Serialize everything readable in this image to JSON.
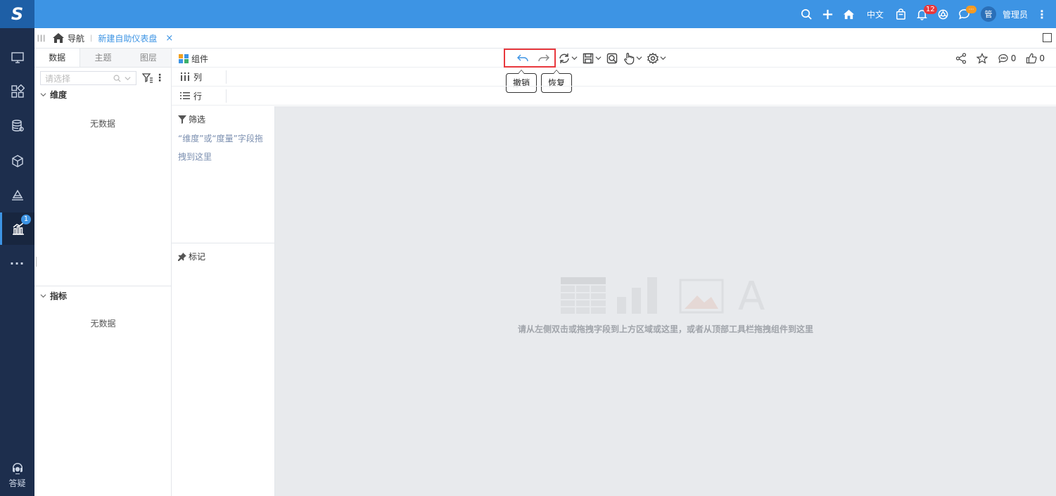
{
  "app": {
    "logo": "S",
    "header": {
      "lang": "中文",
      "notify_count": "12",
      "chat_badge": "···",
      "avatar_text": "管",
      "user_name": "管理员"
    }
  },
  "leftnav": {
    "items": [
      {
        "icon": "monitor-icon"
      },
      {
        "icon": "apps-icon"
      },
      {
        "icon": "database-icon"
      },
      {
        "icon": "cube-icon"
      },
      {
        "icon": "layers-icon"
      },
      {
        "icon": "analysis-icon",
        "badge": "1",
        "active": true
      }
    ],
    "more": "···",
    "help_label": "答疑"
  },
  "breadcrumb": {
    "home_label": "导航",
    "current": "新建自助仪表盘",
    "close": "×"
  },
  "data_panel": {
    "tabs": [
      "数据",
      "主题",
      "图层"
    ],
    "search_placeholder": "请选择",
    "dimension": {
      "title": "维度",
      "empty": "无数据"
    },
    "measure": {
      "title": "指标",
      "empty": "无数据"
    }
  },
  "toolbar": {
    "component_label": "组件",
    "undo_tooltip": "撤销",
    "redo_tooltip": "恢复",
    "comment_count": "0",
    "like_count": "0"
  },
  "shelves": {
    "columns_label": "列",
    "rows_label": "行"
  },
  "filter_panel": {
    "title": "筛选",
    "hint": "“维度”或“度量”字段拖拽到这里",
    "marks_title": "标记"
  },
  "canvas": {
    "empty_hint": "请从左侧双击或拖拽字段到上方区域或这里，或者从顶部工具栏拖拽组件到这里"
  },
  "colors": {
    "header_bg": "#3d94e4",
    "nav_bg": "#1d2e4d",
    "accent": "#3d94e4",
    "highlight_box": "#e8383d",
    "canvas_bg": "#e8eaed"
  }
}
